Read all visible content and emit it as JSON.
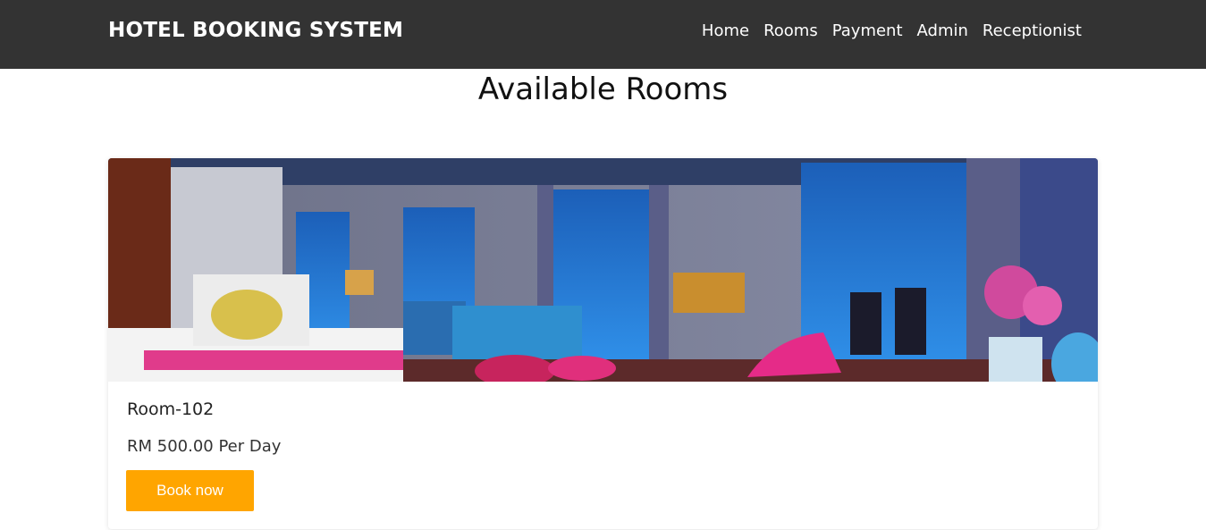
{
  "header": {
    "brand": "HOTEL BOOKING SYSTEM",
    "nav": [
      {
        "label": "Home"
      },
      {
        "label": "Rooms"
      },
      {
        "label": "Payment"
      },
      {
        "label": "Admin"
      },
      {
        "label": "Receptionist"
      }
    ]
  },
  "main": {
    "title": "Available Rooms",
    "rooms": [
      {
        "name": "Room-102",
        "price": "RM 500.00 Per Day",
        "button_label": "Book now",
        "image_alt": "room-photo"
      }
    ]
  },
  "colors": {
    "navbar": "#333333",
    "button": "#ffa500",
    "text": "#222222"
  }
}
